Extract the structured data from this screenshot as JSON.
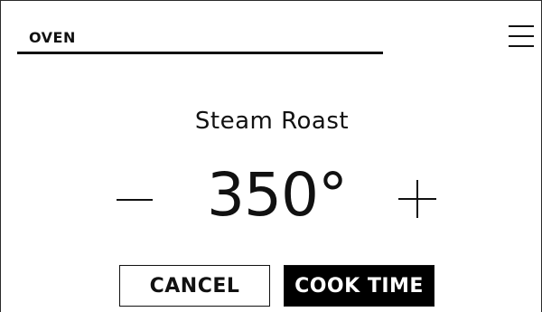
{
  "header": {
    "title": "OVEN",
    "menu_icon": "hamburger-menu-icon"
  },
  "main": {
    "mode": "Steam Roast",
    "temperature": "350°",
    "decrement_icon": "minus-icon",
    "increment_icon": "plus-icon"
  },
  "actions": {
    "cancel_label": "CANCEL",
    "cook_time_label": "COOK TIME"
  },
  "colors": {
    "primary_button": "#000000",
    "text": "#111111",
    "background": "#ffffff"
  }
}
